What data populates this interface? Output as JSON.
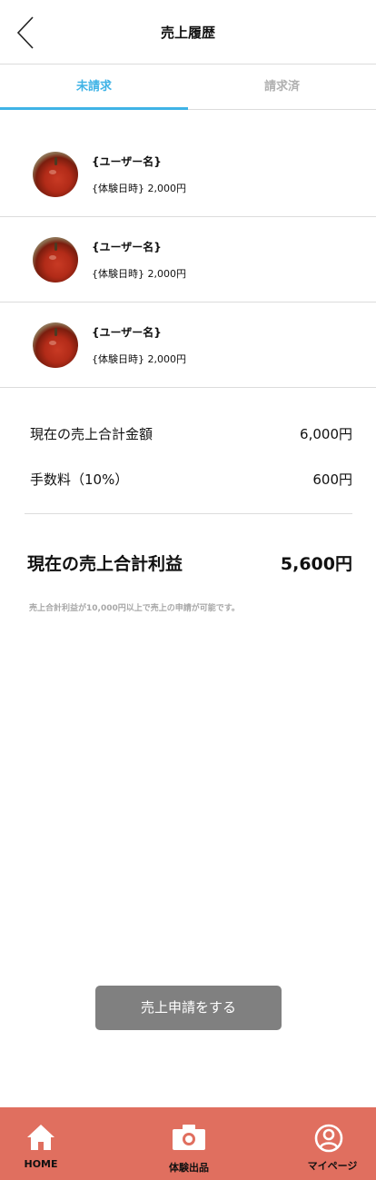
{
  "header": {
    "title": "売上履歴"
  },
  "tabs": [
    {
      "label": "未請求",
      "active": true
    },
    {
      "label": "請求済",
      "active": false
    }
  ],
  "sales": [
    {
      "user": "{ユーザー名}",
      "detail": "{体験日時}  2,000円"
    },
    {
      "user": "{ユーザー名}",
      "detail": "{体験日時}  2,000円"
    },
    {
      "user": "{ユーザー名}",
      "detail": "{体験日時}  2,000円"
    }
  ],
  "summary": {
    "total_amount_label": "現在の売上合計金額",
    "total_amount_value": "6,000円",
    "fee_label": "手数料（10%）",
    "fee_value": "600円",
    "profit_label": "現在の売上合計利益",
    "profit_value": "5,600円",
    "note": "売上合計利益が10,000円以上で売上の申請が可能です。"
  },
  "apply_button": {
    "label": "売上申請をする"
  },
  "bottom_nav": [
    {
      "label": "HOME",
      "icon": "home-icon"
    },
    {
      "label": "体験出品",
      "icon": "camera-icon"
    },
    {
      "label": "マイページ",
      "icon": "user-icon"
    }
  ],
  "colors": {
    "accent": "#3fb3e6",
    "nav_bg": "#e06f5f",
    "button_bg": "#808080"
  }
}
